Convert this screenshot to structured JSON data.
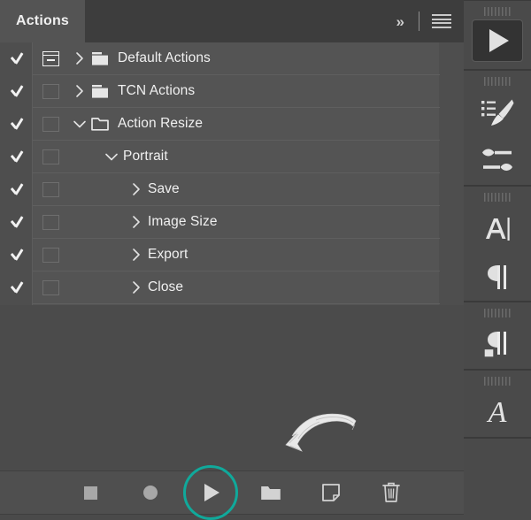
{
  "panel": {
    "tab_label": "Actions",
    "header_icons": {
      "expand_label": "»",
      "menu_name": "panel-menu"
    },
    "rows": [
      {
        "label": "Default Actions",
        "checked": true,
        "toggle": "dialog",
        "chevron": "right",
        "icon": "folder-closed",
        "indent": 0
      },
      {
        "label": "TCN Actions",
        "checked": true,
        "toggle": "empty",
        "chevron": "right",
        "icon": "folder-closed",
        "indent": 0
      },
      {
        "label": "Action Resize",
        "checked": true,
        "toggle": "empty",
        "chevron": "down",
        "icon": "folder-open",
        "indent": 0
      },
      {
        "label": "Portrait",
        "checked": true,
        "toggle": "empty",
        "chevron": "down",
        "icon": "none",
        "indent": 1
      },
      {
        "label": "Save",
        "checked": true,
        "toggle": "empty",
        "chevron": "right",
        "icon": "none",
        "indent": 2
      },
      {
        "label": "Image Size",
        "checked": true,
        "toggle": "empty",
        "chevron": "right",
        "icon": "none",
        "indent": 2
      },
      {
        "label": "Export",
        "checked": true,
        "toggle": "empty",
        "chevron": "right",
        "icon": "none",
        "indent": 2
      },
      {
        "label": "Close",
        "checked": true,
        "toggle": "empty",
        "chevron": "right",
        "icon": "none",
        "indent": 2
      }
    ],
    "toolbar": [
      {
        "name": "stop-playing-button",
        "icon": "stop-square-icon",
        "highlighted": false
      },
      {
        "name": "begin-recording-button",
        "icon": "record-circle-icon",
        "highlighted": false
      },
      {
        "name": "play-selection-button",
        "icon": "play-triangle-icon",
        "highlighted": true
      },
      {
        "name": "create-new-set-button",
        "icon": "folder-icon",
        "highlighted": false
      },
      {
        "name": "create-new-action-button",
        "icon": "new-page-icon",
        "highlighted": false
      },
      {
        "name": "delete-button",
        "icon": "trash-icon",
        "highlighted": false
      }
    ],
    "annotation": {
      "type": "hand-drawn-arrow",
      "points_to": "play-selection-button",
      "highlight_color": "#10a99b"
    }
  },
  "dock": {
    "groups": [
      {
        "items": [
          {
            "icon": "play-triangle-icon",
            "name": "actions-dock-button",
            "boxed": true
          }
        ]
      },
      {
        "items": [
          {
            "icon": "brush-presets-icon",
            "name": "brush-settings-dock-button",
            "boxed": false
          },
          {
            "icon": "brush-sliders-icon",
            "name": "brushes-dock-button",
            "boxed": false
          }
        ]
      },
      {
        "items": [
          {
            "icon": "character-A-icon",
            "name": "character-panel-dock-button",
            "boxed": false
          },
          {
            "icon": "paragraph-pilcrow-icon",
            "name": "paragraph-panel-dock-button",
            "boxed": false
          }
        ]
      },
      {
        "items": [
          {
            "icon": "paragraph-styles-icon",
            "name": "paragraph-styles-dock-button",
            "boxed": false
          }
        ]
      },
      {
        "items": [
          {
            "icon": "glyphs-serif-A-icon",
            "name": "glyphs-dock-button",
            "boxed": false
          }
        ]
      }
    ],
    "glyph_A": "A"
  }
}
